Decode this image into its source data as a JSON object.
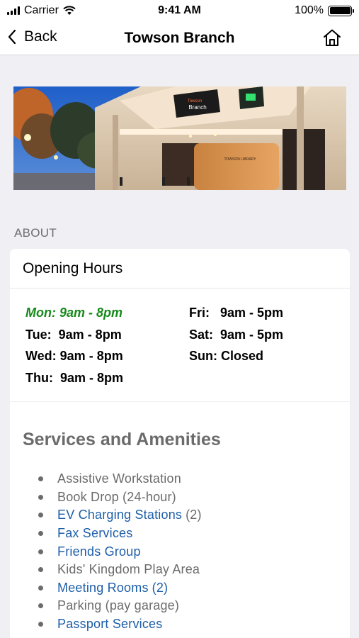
{
  "status": {
    "carrier": "Carrier",
    "time": "9:41 AM",
    "battery": "100%",
    "battery_level": 1.0
  },
  "nav": {
    "back_label": "Back",
    "title": "Towson Branch"
  },
  "hero": {
    "sign_top": "Towson",
    "sign_bottom": "Branch",
    "building_text": "TOWSON LIBRARY"
  },
  "about_label": "ABOUT",
  "hours": {
    "heading": "Opening Hours",
    "rows": [
      {
        "text": "Mon: 9am - 8pm"
      },
      {
        "text": "Tue:  9am - 8pm"
      },
      {
        "text": "Wed: 9am - 8pm"
      },
      {
        "text": "Thu:  9am - 8pm"
      },
      {
        "text": "Fri:   9am - 5pm"
      },
      {
        "text": "Sat:  9am - 5pm"
      },
      {
        "text": "Sun: Closed"
      }
    ]
  },
  "services": {
    "title": "Services and Amenities",
    "items": [
      {
        "label": "Assistive Workstation"
      },
      {
        "label": "Book Drop (24-hour)"
      },
      {
        "label": "EV Charging Stations",
        "count": "(2)"
      },
      {
        "label": "Fax Services"
      },
      {
        "label": "Friends Group"
      },
      {
        "label": "Kids' Kingdom Play Area"
      },
      {
        "label": "Meeting Rooms",
        "count": "(2)"
      },
      {
        "label": "Parking (pay garage)"
      },
      {
        "label": "Passport Services"
      }
    ]
  },
  "colors": {
    "today": "#178a1b",
    "link": "#1d5ea8",
    "muted": "#6b6b6b",
    "background": "#efeff4"
  }
}
